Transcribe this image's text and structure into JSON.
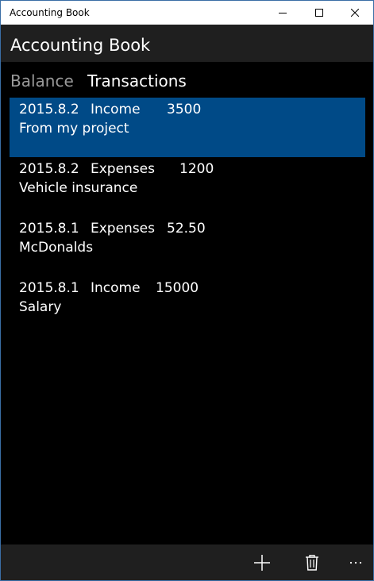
{
  "window": {
    "title": "Accounting Book"
  },
  "header": {
    "title": "Accounting Book"
  },
  "tabs": [
    {
      "label": "Balance",
      "active": false
    },
    {
      "label": "Transactions",
      "active": true
    }
  ],
  "transactions": [
    {
      "date": "2015.8.2",
      "type": "Income",
      "amount": "3500",
      "note": "From my project",
      "selected": true
    },
    {
      "date": "2015.8.2",
      "type": "Expenses",
      "amount": "1200",
      "note": "Vehicle insurance",
      "selected": false
    },
    {
      "date": "2015.8.1",
      "type": "Expenses",
      "amount": "52.50",
      "note": "McDonalds",
      "selected": false
    },
    {
      "date": "2015.8.1",
      "type": "Income",
      "amount": "15000",
      "note": "Salary",
      "selected": false
    }
  ],
  "appbar": {
    "add_icon": "plus-icon",
    "delete_icon": "trash-icon",
    "more_icon": "ellipsis-icon"
  },
  "colors": {
    "selection": "#004a87",
    "header_bg": "#1f1f1f",
    "background": "#000000",
    "inactive_tab": "#9a9a9a"
  }
}
